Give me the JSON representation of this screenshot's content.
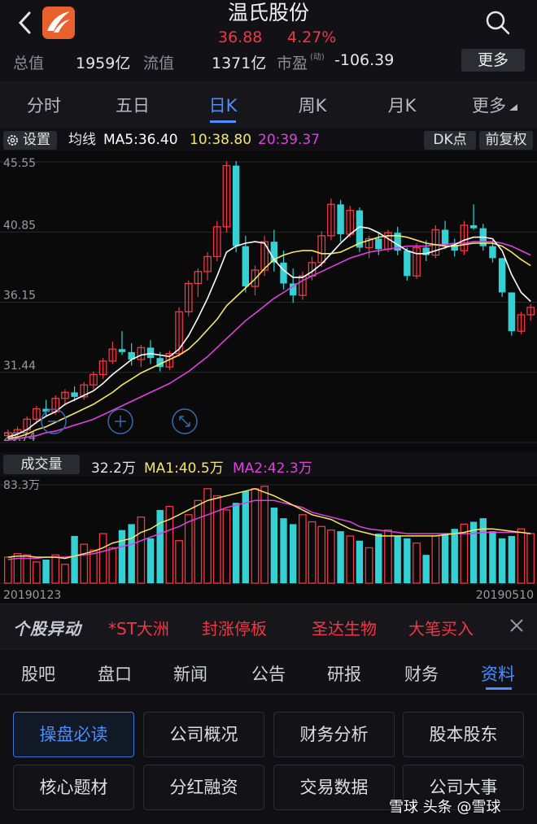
{
  "header": {
    "title": "温氏股份",
    "price": "36.88",
    "change": "4.27%",
    "total_label": "总值",
    "total_value": "1959亿",
    "float_label": "流值",
    "float_value": "1371亿",
    "pe_label": "市盈",
    "pe_sup": "(动)",
    "pe_value": "-106.39",
    "more_label": "更多"
  },
  "tabs": [
    "分时",
    "五日",
    "日K",
    "周K",
    "月K",
    "更多"
  ],
  "active_tab": "日K",
  "toolbar": {
    "settings_label": "设置",
    "ma_title": "均线",
    "ma5": "MA5:36.40",
    "ma10": "10:38.80",
    "ma20": "20:39.37",
    "dk_label": "DK点",
    "fq_label": "前复权"
  },
  "colors": {
    "up": "#f23645",
    "down": "#35d0d4",
    "ma5": "#ffffff",
    "ma10": "#f5e663",
    "ma20": "#e040e0",
    "accent": "#4c8dff"
  },
  "chart_data": [
    {
      "type": "candlestick",
      "ylim": [
        26.74,
        45.55
      ],
      "y_ticks": [
        "45.55",
        "40.85",
        "36.15",
        "31.44",
        "26.74"
      ],
      "ohlc": [
        [
          27.2,
          27.6,
          26.9,
          27.4
        ],
        [
          27.4,
          27.8,
          27.0,
          27.6
        ],
        [
          27.6,
          28.5,
          27.4,
          28.3
        ],
        [
          28.3,
          29.2,
          28.0,
          29.0
        ],
        [
          29.0,
          29.6,
          28.5,
          28.8
        ],
        [
          28.8,
          29.9,
          28.6,
          29.7
        ],
        [
          29.7,
          30.3,
          29.2,
          30.1
        ],
        [
          30.1,
          30.5,
          29.5,
          29.8
        ],
        [
          29.8,
          30.8,
          29.6,
          30.6
        ],
        [
          30.6,
          31.5,
          30.3,
          31.3
        ],
        [
          31.3,
          32.4,
          31.0,
          32.2
        ],
        [
          32.2,
          33.5,
          32.0,
          33.0
        ],
        [
          33.0,
          34.2,
          32.6,
          32.8
        ],
        [
          32.8,
          33.4,
          31.9,
          32.3
        ],
        [
          32.3,
          33.3,
          31.8,
          33.1
        ],
        [
          33.1,
          33.6,
          32.0,
          32.4
        ],
        [
          32.4,
          32.8,
          31.5,
          31.8
        ],
        [
          31.8,
          32.9,
          31.6,
          32.7
        ],
        [
          32.7,
          35.8,
          32.5,
          35.5
        ],
        [
          35.5,
          37.6,
          35.2,
          37.4
        ],
        [
          37.4,
          38.4,
          36.5,
          38.2
        ],
        [
          38.2,
          39.5,
          37.6,
          39.2
        ],
        [
          39.2,
          41.6,
          38.9,
          41.2
        ],
        [
          41.2,
          45.6,
          40.8,
          45.3
        ],
        [
          45.3,
          45.6,
          39.5,
          39.9
        ],
        [
          39.9,
          40.6,
          36.8,
          37.2
        ],
        [
          37.2,
          38.6,
          36.6,
          38.3
        ],
        [
          38.3,
          40.6,
          37.9,
          40.2
        ],
        [
          40.2,
          41.0,
          38.2,
          38.8
        ],
        [
          38.8,
          39.6,
          37.0,
          37.4
        ],
        [
          37.4,
          38.4,
          36.1,
          36.6
        ],
        [
          36.6,
          38.2,
          36.3,
          37.9
        ],
        [
          37.9,
          39.2,
          37.6,
          38.8
        ],
        [
          38.8,
          40.9,
          38.5,
          40.6
        ],
        [
          40.6,
          43.1,
          40.3,
          42.7
        ],
        [
          42.7,
          43.0,
          40.2,
          40.7
        ],
        [
          40.7,
          42.6,
          40.5,
          42.3
        ],
        [
          42.3,
          42.5,
          39.5,
          39.8
        ],
        [
          39.8,
          40.6,
          39.1,
          40.4
        ],
        [
          40.4,
          40.8,
          39.3,
          39.7
        ],
        [
          39.7,
          41.0,
          39.5,
          40.8
        ],
        [
          40.8,
          41.2,
          39.3,
          39.6
        ],
        [
          39.6,
          39.8,
          37.6,
          37.9
        ],
        [
          37.9,
          40.1,
          37.7,
          39.8
        ],
        [
          39.8,
          40.3,
          38.9,
          39.3
        ],
        [
          39.3,
          41.3,
          39.1,
          41.0
        ],
        [
          41.0,
          41.6,
          39.7,
          40.0
        ],
        [
          40.0,
          40.4,
          39.2,
          39.6
        ],
        [
          39.6,
          41.6,
          39.3,
          41.3
        ],
        [
          41.3,
          42.7,
          41.0,
          41.1
        ],
        [
          41.1,
          41.4,
          39.6,
          39.9
        ],
        [
          39.9,
          40.3,
          38.8,
          39.1
        ],
        [
          39.1,
          38.8,
          36.5,
          36.8
        ],
        [
          36.8,
          35.8,
          33.9,
          34.2
        ],
        [
          34.2,
          35.5,
          34.0,
          35.3
        ],
        [
          35.3,
          36.0,
          34.9,
          35.8
        ]
      ],
      "ma5": [
        27.1,
        27.3,
        27.6,
        28.1,
        28.5,
        28.8,
        29.3,
        29.6,
        29.9,
        30.2,
        30.7,
        31.3,
        31.8,
        32.3,
        32.6,
        32.7,
        32.6,
        32.5,
        33.0,
        33.9,
        35.1,
        36.4,
        37.9,
        39.5,
        39.9,
        40.1,
        40.2,
        40.1,
        39.0,
        38.3,
        37.8,
        37.8,
        38.2,
        38.7,
        39.4,
        40.1,
        40.7,
        41.2,
        41.1,
        40.8,
        40.4,
        40.0,
        39.6,
        39.4,
        39.4,
        39.6,
        39.8,
        40.0,
        40.3,
        40.5,
        40.5,
        40.4,
        39.6,
        38.0,
        36.8,
        36.2
      ],
      "ma10": [
        27.0,
        27.1,
        27.3,
        27.6,
        27.8,
        28.1,
        28.4,
        28.7,
        29.0,
        29.3,
        29.7,
        30.1,
        30.6,
        31.0,
        31.4,
        31.7,
        32.0,
        32.3,
        32.6,
        33.0,
        33.6,
        34.3,
        35.0,
        35.9,
        36.5,
        37.1,
        37.7,
        38.4,
        39.0,
        39.3,
        39.5,
        39.6,
        39.6,
        39.4,
        39.4,
        39.5,
        39.8,
        40.1,
        40.3,
        40.5,
        40.6,
        40.6,
        40.5,
        40.3,
        40.1,
        40.0,
        39.9,
        39.9,
        40.0,
        40.1,
        40.1,
        40.1,
        39.9,
        39.5,
        39.0,
        38.6
      ],
      "ma20": [
        26.9,
        27.0,
        27.1,
        27.2,
        27.4,
        27.5,
        27.7,
        27.9,
        28.1,
        28.3,
        28.6,
        28.9,
        29.2,
        29.5,
        29.8,
        30.1,
        30.4,
        30.7,
        31.1,
        31.5,
        32.0,
        32.5,
        33.1,
        33.7,
        34.3,
        34.9,
        35.4,
        35.9,
        36.4,
        36.8,
        37.2,
        37.6,
        37.9,
        38.2,
        38.5,
        38.8,
        39.1,
        39.3,
        39.5,
        39.6,
        39.7,
        39.8,
        39.9,
        39.9,
        39.9,
        40.0,
        40.0,
        40.1,
        40.1,
        40.2,
        40.2,
        40.2,
        40.1,
        39.9,
        39.6,
        39.3
      ]
    },
    {
      "type": "bar",
      "ylim": [
        0,
        83.3
      ],
      "y_top_label": "83.3万",
      "x_start": "20190123",
      "x_end": "20190510",
      "values": [
        22,
        25,
        24,
        18,
        20,
        24,
        16,
        40,
        33,
        28,
        42,
        30,
        45,
        50,
        56,
        38,
        62,
        65,
        36,
        58,
        70,
        80,
        74,
        62,
        68,
        78,
        80,
        82,
        64,
        55,
        50,
        58,
        52,
        48,
        45,
        44,
        40,
        36,
        30,
        42,
        45,
        40,
        38,
        34,
        24,
        40,
        42,
        46,
        50,
        52,
        55,
        44,
        38,
        40,
        46,
        42
      ],
      "ma1": [
        22,
        23,
        23,
        22,
        22,
        22,
        21,
        23,
        25,
        27,
        30,
        34,
        36,
        38,
        43,
        46,
        51,
        54,
        58,
        62,
        66,
        70,
        72,
        74,
        76,
        78,
        80,
        77,
        74,
        70,
        66,
        62,
        58,
        56,
        54,
        50,
        46,
        44,
        42,
        40,
        40,
        40,
        40,
        40,
        40,
        40,
        41,
        42,
        43,
        45,
        46,
        46,
        45,
        44,
        43,
        42
      ],
      "ma2": [
        20,
        21,
        21,
        21,
        22,
        22,
        22,
        23,
        24,
        25,
        27,
        29,
        31,
        33,
        36,
        39,
        42,
        45,
        48,
        52,
        55,
        58,
        61,
        64,
        66,
        68,
        70,
        70,
        70,
        68,
        66,
        64,
        60,
        58,
        56,
        54,
        52,
        48,
        46,
        45,
        44,
        43,
        42,
        42,
        42,
        42,
        42,
        42,
        42,
        42,
        43,
        43,
        43,
        43,
        43,
        42
      ]
    }
  ],
  "volume_toolbar": {
    "label": "成交量",
    "current": "32.2万",
    "ma1": "MA1:40.5万",
    "ma2": "MA2:42.3万"
  },
  "news": {
    "logo": "个股异动",
    "items": [
      "*ST大洲",
      "封涨停板",
      "圣达生物",
      "大笔买入"
    ]
  },
  "sub_tabs": [
    "股吧",
    "盘口",
    "新闻",
    "公告",
    "研报",
    "财务",
    "资料"
  ],
  "active_sub_tab": "资料",
  "grid_buttons": [
    "操盘必读",
    "公司概况",
    "财务分析",
    "股本股东",
    "核心题材",
    "分红融资",
    "交易数据",
    "公司大事"
  ],
  "watermark": "头条 @雪球",
  "watermark_brand": "雪球"
}
